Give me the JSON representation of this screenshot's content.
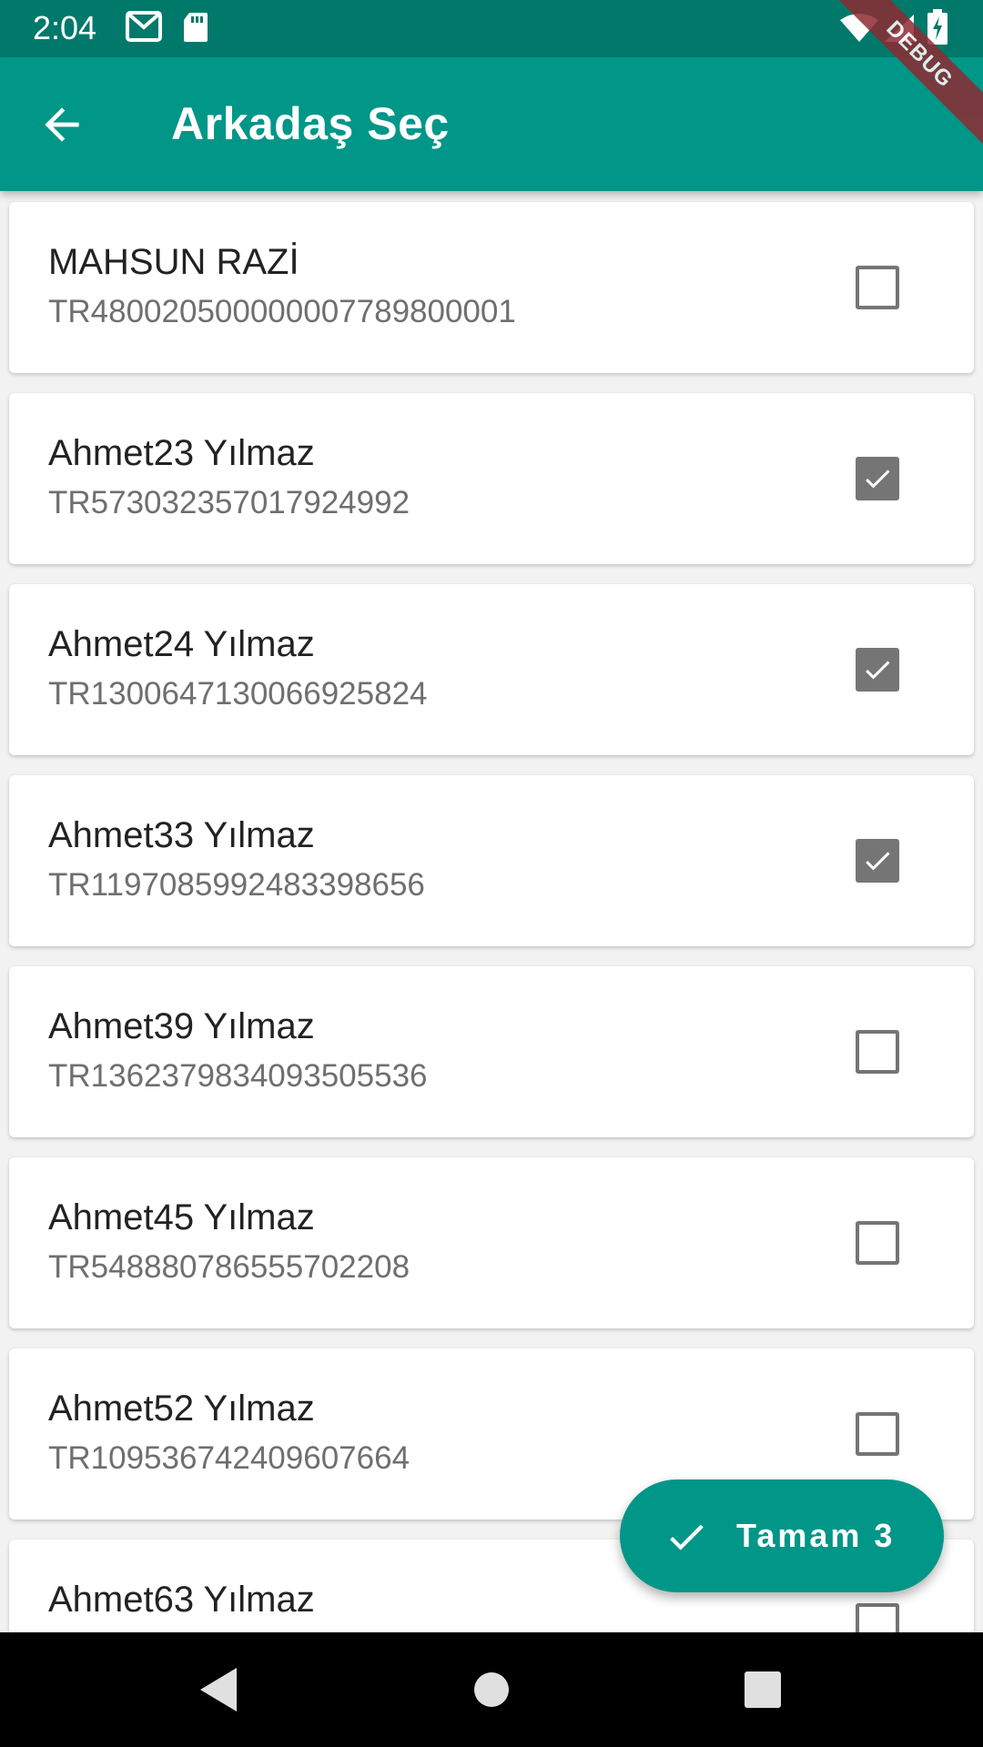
{
  "status_bar": {
    "time": "2:04",
    "icons": [
      "gmail-icon",
      "sd-card-icon",
      "wifi-icon",
      "signal-icon",
      "battery-charging-icon"
    ]
  },
  "debug_banner": "DEBUG",
  "app_bar": {
    "title": "Arkadaş Seç",
    "back_icon": "arrow-back-icon"
  },
  "friends": [
    {
      "name": "MAHSUN RAZİ",
      "iban": "TR480020500000007789800001",
      "checked": false
    },
    {
      "name": "Ahmet23 Yılmaz",
      "iban": "TR573032357017924992",
      "checked": true
    },
    {
      "name": "Ahmet24 Yılmaz",
      "iban": "TR130064713006692582​4",
      "checked": true
    },
    {
      "name": "Ahmet33 Yılmaz",
      "iban": "TR119708599248339865​6",
      "checked": true
    },
    {
      "name": "Ahmet39 Yılmaz",
      "iban": "TR136237983409350553​6",
      "checked": false
    },
    {
      "name": "Ahmet45 Yılmaz",
      "iban": "TR548880786555702208",
      "checked": false
    },
    {
      "name": "Ahmet52 Yılmaz",
      "iban": "TR109536742409607664",
      "checked": false
    },
    {
      "name": "Ahmet63 Yılmaz",
      "iban": "",
      "checked": false
    }
  ],
  "fab": {
    "label": "Tamam 3",
    "icon": "check-icon"
  },
  "nav_bar": {
    "icons": [
      "back-triangle-icon",
      "home-circle-icon",
      "recents-square-icon"
    ]
  },
  "colors": {
    "primary": "#009688",
    "primary_dark": "#00796b",
    "checkbox_gray": "#757575"
  }
}
